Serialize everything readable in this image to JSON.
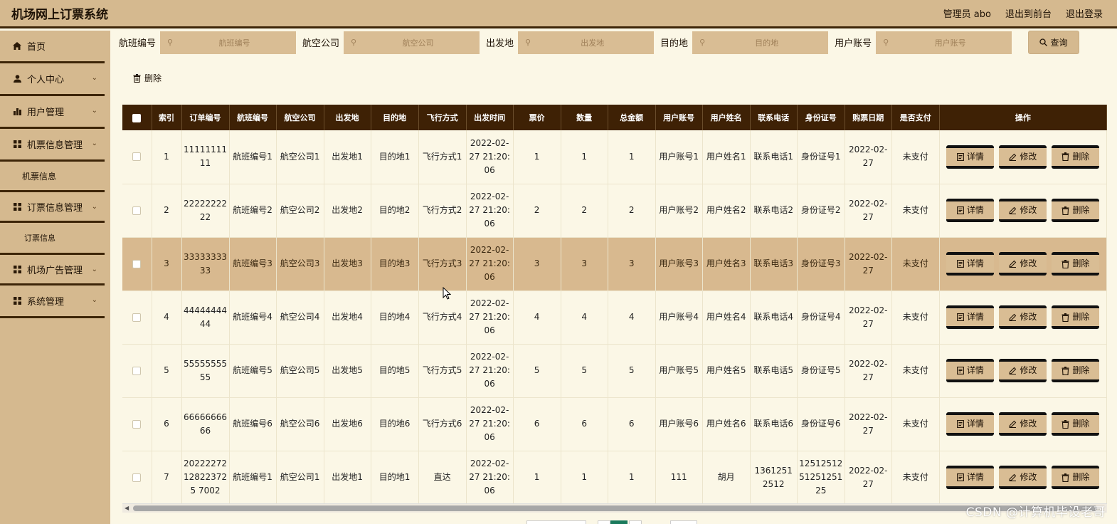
{
  "app_title": "机场网上订票系统",
  "header": {
    "user": "管理员 abo",
    "to_front": "退出到前台",
    "logout": "退出登录"
  },
  "sidebar": {
    "items": [
      {
        "label": "首页",
        "icon": "home-icon"
      },
      {
        "label": "个人中心",
        "icon": "user-icon"
      },
      {
        "label": "用户管理",
        "icon": "bar-chart-icon"
      },
      {
        "label": "机票信息管理",
        "icon": "grid-icon"
      },
      {
        "label": "机票信息",
        "sub": true
      },
      {
        "label": "订票信息管理",
        "icon": "grid-icon"
      },
      {
        "label": "订票信息",
        "sub": true
      },
      {
        "label": "机场广告管理",
        "icon": "grid-icon"
      },
      {
        "label": "系统管理",
        "icon": "grid-icon"
      }
    ]
  },
  "search": {
    "fields": [
      {
        "label": "航班编号",
        "placeholder": "航班编号"
      },
      {
        "label": "航空公司",
        "placeholder": "航空公司"
      },
      {
        "label": "出发地",
        "placeholder": "出发地"
      },
      {
        "label": "目的地",
        "placeholder": "目的地"
      },
      {
        "label": "用户账号",
        "placeholder": "用户账号"
      }
    ],
    "query_label": "查询"
  },
  "toolbar": {
    "delete_label": "删除"
  },
  "table": {
    "headers": [
      "索引",
      "订单编号",
      "航班编号",
      "航空公司",
      "出发地",
      "目的地",
      "飞行方式",
      "出发时间",
      "票价",
      "数量",
      "总金额",
      "用户账号",
      "用户姓名",
      "联系电话",
      "身份证号",
      "购票日期",
      "是否支付",
      "操作"
    ],
    "rows": [
      [
        "1",
        "1111111111",
        "航班编号1",
        "航空公司1",
        "出发地1",
        "目的地1",
        "飞行方式1",
        "2022-02-27 21:20:06",
        "1",
        "1",
        "1",
        "用户账号1",
        "用户姓名1",
        "联系电话1",
        "身份证号1",
        "2022-02-27",
        "未支付"
      ],
      [
        "2",
        "2222222222",
        "航班编号2",
        "航空公司2",
        "出发地2",
        "目的地2",
        "飞行方式2",
        "2022-02-27 21:20:06",
        "2",
        "2",
        "2",
        "用户账号2",
        "用户姓名2",
        "联系电话2",
        "身份证号2",
        "2022-02-27",
        "未支付"
      ],
      [
        "3",
        "3333333333",
        "航班编号3",
        "航空公司3",
        "出发地3",
        "目的地3",
        "飞行方式3",
        "2022-02-27 21:20:06",
        "3",
        "3",
        "3",
        "用户账号3",
        "用户姓名3",
        "联系电话3",
        "身份证号3",
        "2022-02-27",
        "未支付"
      ],
      [
        "4",
        "4444444444",
        "航班编号4",
        "航空公司4",
        "出发地4",
        "目的地4",
        "飞行方式4",
        "2022-02-27 21:20:06",
        "4",
        "4",
        "4",
        "用户账号4",
        "用户姓名4",
        "联系电话4",
        "身份证号4",
        "2022-02-27",
        "未支付"
      ],
      [
        "5",
        "5555555555",
        "航班编号5",
        "航空公司5",
        "出发地5",
        "目的地5",
        "飞行方式5",
        "2022-02-27 21:20:06",
        "5",
        "5",
        "5",
        "用户账号5",
        "用户姓名5",
        "联系电话5",
        "身份证号5",
        "2022-02-27",
        "未支付"
      ],
      [
        "6",
        "6666666666",
        "航班编号6",
        "航空公司6",
        "出发地6",
        "目的地6",
        "飞行方式6",
        "2022-02-27 21:20:06",
        "6",
        "6",
        "6",
        "用户账号6",
        "用户姓名6",
        "联系电话6",
        "身份证号6",
        "2022-02-27",
        "未支付"
      ],
      [
        "7",
        "20222272128223725 7002",
        "航班编号1",
        "航空公司1",
        "出发地1",
        "目的地1",
        "直达",
        "2022-02-27 21:20:06",
        "1",
        "1",
        "1",
        "111",
        "胡月",
        "13612512512",
        "125125125125125125",
        "2022-02-27",
        "未支付"
      ]
    ],
    "actions": {
      "detail": "详情",
      "edit": "修改",
      "delete": "删除"
    },
    "highlight_row_index": 2
  },
  "watermark": "CSDN @计算机毕设老哥",
  "colors": {
    "header_bg": "#d5b98f",
    "table_header_bg": "#3e2105",
    "content_bg": "#fbf7e6",
    "highlight_row": "#d8b98f",
    "pager_active": "#1a7a5c"
  }
}
